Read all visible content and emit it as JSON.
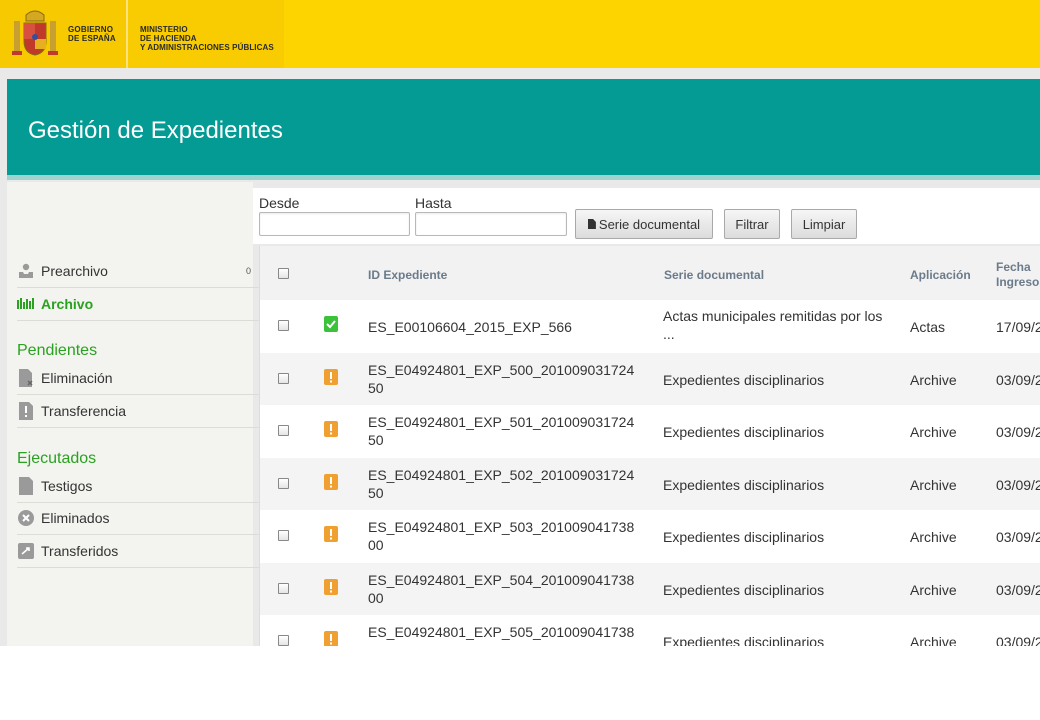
{
  "header": {
    "gov_line1": "GOBIERNO",
    "gov_line2": "DE ESPAÑA",
    "ministry_line1": "MINISTERIO",
    "ministry_line2": "DE HACIENDA",
    "ministry_line3": "Y ADMINISTRACIONES PÚBLICAS",
    "brand_color": "#fdd400"
  },
  "page_title": "Gestión de Expedientes",
  "accent_color": "#049b95",
  "sidebar": {
    "preachivo": {
      "label": "Prearchivo",
      "count": "0",
      "icon": "inbox-icon"
    },
    "archivo": {
      "label": "Archivo",
      "icon": "archive-bars-icon"
    },
    "pendientes_title": "Pendientes",
    "eliminacion": {
      "label": "Eliminación",
      "icon": "document-delete-icon"
    },
    "transferencia": {
      "label": "Transferencia",
      "icon": "document-warning-icon"
    },
    "ejecutados_title": "Ejecutados",
    "testigos": {
      "label": "Testigos",
      "icon": "document-icon"
    },
    "eliminados": {
      "label": "Eliminados",
      "icon": "x-circle-icon"
    },
    "transferidos": {
      "label": "Transferidos",
      "icon": "transfer-icon"
    }
  },
  "filters": {
    "desde_label": "Desde",
    "desde_value": "",
    "hasta_label": "Hasta",
    "hasta_value": "",
    "serie_button": "Serie documental",
    "filtrar_button": "Filtrar",
    "limpiar_button": "Limpiar"
  },
  "table": {
    "columns": {
      "id": "ID Expediente",
      "serie": "Serie documental",
      "aplicacion": "Aplicación",
      "fecha_line1": "Fecha",
      "fecha_line2": "Ingreso"
    },
    "rows": [
      {
        "status": "ok",
        "id": "ES_E00106604_2015_EXP_566",
        "serie": "Actas municipales remitidas por los ...",
        "aplicacion": "Actas",
        "fecha": "17/09/2"
      },
      {
        "status": "warn",
        "id": "ES_E04924801_EXP_500_20100903172450",
        "serie": "Expedientes disciplinarios",
        "aplicacion": "Archive",
        "fecha": "03/09/2"
      },
      {
        "status": "warn",
        "id": "ES_E04924801_EXP_501_20100903172450",
        "serie": "Expedientes disciplinarios",
        "aplicacion": "Archive",
        "fecha": "03/09/2"
      },
      {
        "status": "warn",
        "id": "ES_E04924801_EXP_502_20100903172450",
        "serie": "Expedientes disciplinarios",
        "aplicacion": "Archive",
        "fecha": "03/09/2"
      },
      {
        "status": "warn",
        "id": "ES_E04924801_EXP_503_20100904173800",
        "serie": "Expedientes disciplinarios",
        "aplicacion": "Archive",
        "fecha": "03/09/2"
      },
      {
        "status": "warn",
        "id": "ES_E04924801_EXP_504_20100904173800",
        "serie": "Expedientes disciplinarios",
        "aplicacion": "Archive",
        "fecha": "03/09/2"
      },
      {
        "status": "warn",
        "id": "ES_E04924801_EXP_505_201009041738",
        "serie": "Expedientes disciplinarios",
        "aplicacion": "Archive",
        "fecha": "03/09/2"
      }
    ]
  }
}
